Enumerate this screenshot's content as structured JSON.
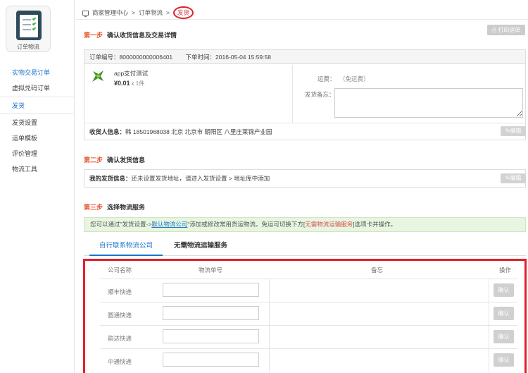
{
  "sidebar": {
    "logo_label": "订单物流",
    "group1": [
      {
        "label": "实物交易订单",
        "active": true
      },
      {
        "label": "虚拟兑码订单",
        "active": false
      }
    ],
    "current": "发货",
    "group2": [
      {
        "label": "发货设置"
      },
      {
        "label": "运单模板"
      },
      {
        "label": "评价管理"
      },
      {
        "label": "物流工具"
      }
    ]
  },
  "breadcrumb": {
    "home": "商家管理中心",
    "sep1": ">",
    "section": "订单物流",
    "sep2": ">",
    "current": "发货"
  },
  "step1": {
    "num": "第一步",
    "title": "确认收货信息及交易详情",
    "print_label": "打印运单",
    "order_no_label": "订单编号：",
    "order_no": "8000000000006401",
    "order_time_label": "下单时间：",
    "order_time": "2016-05-04 15:59:58",
    "product_name": "app支付测试",
    "price": "¥0.01",
    "qty": "x 1件",
    "freight_label": "运费：",
    "freight_value": "（免运费）",
    "note_label": "发货备忘：",
    "receiver_label": "收货人信息：",
    "receiver_value": "韩 18501968038 北京 北京市 朝阳区 八里庄莱锦产业园",
    "edit_label": "编辑"
  },
  "step2": {
    "num": "第二步",
    "title": "确认发货信息",
    "label": "我的发货信息：",
    "value": "还未设置发货地址，请进入发货设置 > 地址库中添加",
    "edit_label": "编辑"
  },
  "step3": {
    "num": "第三步",
    "title": "选择物流服务",
    "tip_prefix": "您可以通过\"发货设置->",
    "tip_link": "默认物流公司",
    "tip_middle": "\"添加或修改常用货运物流。免运可切换下方[",
    "tip_warn": "无需物流运输服务",
    "tip_suffix": "]选项卡并操作。",
    "tabs": [
      "自行联系物流公司",
      "无需物流运输服务"
    ],
    "columns": {
      "name": "公司名称",
      "no": "物流单号",
      "note": "备忘",
      "op": "操作"
    },
    "rows": [
      {
        "name": "顺丰快递",
        "button": "确认"
      },
      {
        "name": "圆通快递",
        "button": "确认"
      },
      {
        "name": "韵达快递",
        "button": "确认"
      },
      {
        "name": "中通快递",
        "button": "确认"
      }
    ]
  },
  "colors": {
    "accent_blue": "#1a75c9",
    "step_orange": "#e8532b",
    "highlight_red": "#e0202a",
    "tip_green_bg": "#e8f5e1"
  }
}
